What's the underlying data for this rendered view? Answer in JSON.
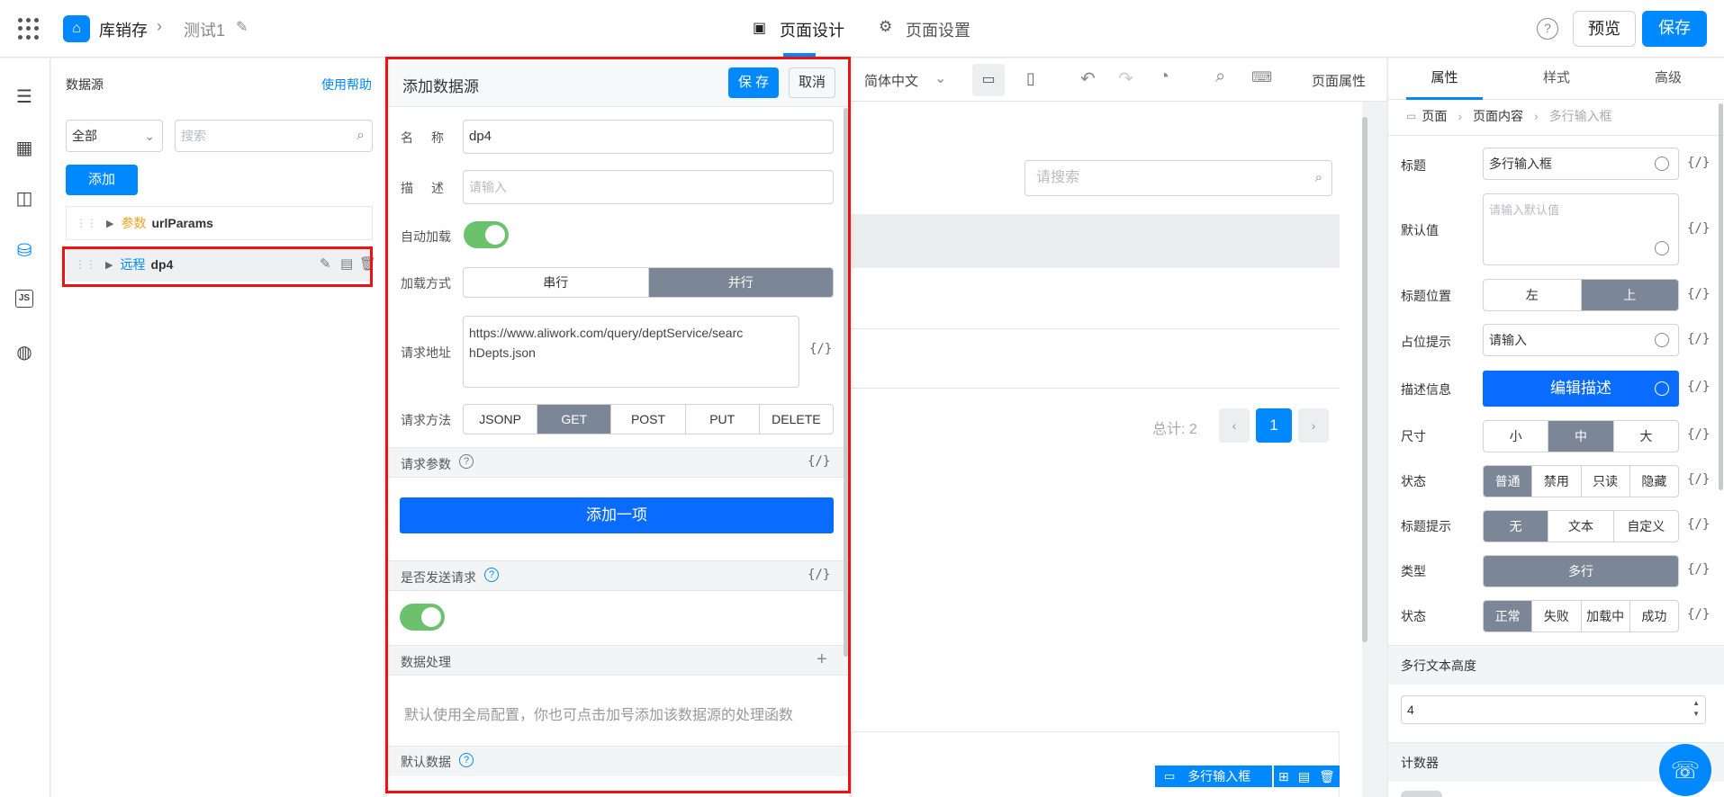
{
  "topbar": {
    "app_name": "库销存",
    "page_name": "测试1",
    "tab_design": "页面设计",
    "tab_settings": "页面设置",
    "help_symbol": "?",
    "preview_label": "预览",
    "save_label": "保存"
  },
  "datasource_panel": {
    "title": "数据源",
    "help_link": "使用帮助",
    "filter_value": "全部",
    "search_placeholder": "搜索",
    "add_label": "添加",
    "items": [
      {
        "type_label": "参数",
        "name": "urlParams"
      },
      {
        "type_label": "远程",
        "name": "dp4"
      }
    ]
  },
  "add_datasource_form": {
    "title": "添加数据源",
    "save_label": "保 存",
    "cancel_label": "取消",
    "name_label_a": "名",
    "name_label_b": "称",
    "name_value": "dp4",
    "desc_label_a": "描",
    "desc_label_b": "述",
    "desc_placeholder": "请输入",
    "auto_load_label": "自动加载",
    "load_mode_label": "加载方式",
    "load_modes": [
      "串行",
      "并行"
    ],
    "url_label": "请求地址",
    "url_value_line1": "https://www.aliwork.com/query/deptService/searc",
    "url_value_line2": "hDepts.json",
    "fx_label": "{/}",
    "method_label": "请求方法",
    "methods": [
      "JSONP",
      "GET",
      "POST",
      "PUT",
      "DELETE"
    ],
    "params_label": "请求参数",
    "add_item_label": "添加一项",
    "send_request_label": "是否发送请求",
    "data_processing_label": "数据处理",
    "data_processing_hint": "默认使用全局配置，你也可点击加号添加该数据源的处理函数",
    "default_data_label": "默认数据"
  },
  "canvas": {
    "language": "简体中文",
    "page_props_label": "页面属性",
    "search_placeholder": "请搜索",
    "total_label": "总计: 2",
    "current_page": "1",
    "selected_component_label": "多行输入框"
  },
  "props_panel": {
    "tabs": [
      "属性",
      "样式",
      "高级"
    ],
    "breadcrumb": [
      "页面",
      "页面内容",
      "多行输入框"
    ],
    "fields": {
      "title_label": "标题",
      "title_value": "多行输入框",
      "default_label": "默认值",
      "default_placeholder": "请输入默认值",
      "title_pos_label": "标题位置",
      "title_pos_options": [
        "左",
        "上"
      ],
      "placeholder_label": "占位提示",
      "placeholder_value": "请输入",
      "desc_label": "描述信息",
      "desc_button": "编辑描述",
      "size_label": "尺寸",
      "size_options": [
        "小",
        "中",
        "大"
      ],
      "state_label": "状态",
      "state_options": [
        "普通",
        "禁用",
        "只读",
        "隐藏"
      ],
      "title_tip_label": "标题提示",
      "title_tip_options": [
        "无",
        "文本",
        "自定义"
      ],
      "type_label": "类型",
      "type_value": "多行",
      "status_label": "状态",
      "status_options": [
        "正常",
        "失败",
        "加载中",
        "成功"
      ]
    },
    "rows_height_label": "多行文本高度",
    "rows_height_value": "4",
    "counter_label": "计数器"
  },
  "colors": {
    "primary": "#0089ff",
    "segment_active": "#7b8797",
    "toggle_on": "#6cc26c",
    "highlight_border": "#ee1111",
    "type_param": "#f0a020"
  }
}
